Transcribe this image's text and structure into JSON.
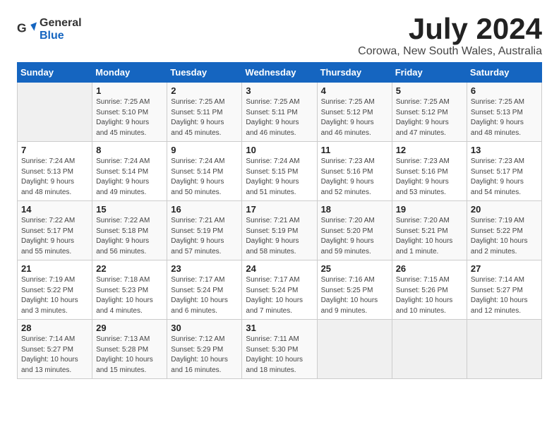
{
  "logo": {
    "general": "General",
    "blue": "Blue"
  },
  "title": "July 2024",
  "location": "Corowa, New South Wales, Australia",
  "days_header": [
    "Sunday",
    "Monday",
    "Tuesday",
    "Wednesday",
    "Thursday",
    "Friday",
    "Saturday"
  ],
  "weeks": [
    [
      {
        "day": "",
        "info": ""
      },
      {
        "day": "1",
        "info": "Sunrise: 7:25 AM\nSunset: 5:10 PM\nDaylight: 9 hours\nand 45 minutes."
      },
      {
        "day": "2",
        "info": "Sunrise: 7:25 AM\nSunset: 5:11 PM\nDaylight: 9 hours\nand 45 minutes."
      },
      {
        "day": "3",
        "info": "Sunrise: 7:25 AM\nSunset: 5:11 PM\nDaylight: 9 hours\nand 46 minutes."
      },
      {
        "day": "4",
        "info": "Sunrise: 7:25 AM\nSunset: 5:12 PM\nDaylight: 9 hours\nand 46 minutes."
      },
      {
        "day": "5",
        "info": "Sunrise: 7:25 AM\nSunset: 5:12 PM\nDaylight: 9 hours\nand 47 minutes."
      },
      {
        "day": "6",
        "info": "Sunrise: 7:25 AM\nSunset: 5:13 PM\nDaylight: 9 hours\nand 48 minutes."
      }
    ],
    [
      {
        "day": "7",
        "info": "Sunrise: 7:24 AM\nSunset: 5:13 PM\nDaylight: 9 hours\nand 48 minutes."
      },
      {
        "day": "8",
        "info": "Sunrise: 7:24 AM\nSunset: 5:14 PM\nDaylight: 9 hours\nand 49 minutes."
      },
      {
        "day": "9",
        "info": "Sunrise: 7:24 AM\nSunset: 5:14 PM\nDaylight: 9 hours\nand 50 minutes."
      },
      {
        "day": "10",
        "info": "Sunrise: 7:24 AM\nSunset: 5:15 PM\nDaylight: 9 hours\nand 51 minutes."
      },
      {
        "day": "11",
        "info": "Sunrise: 7:23 AM\nSunset: 5:16 PM\nDaylight: 9 hours\nand 52 minutes."
      },
      {
        "day": "12",
        "info": "Sunrise: 7:23 AM\nSunset: 5:16 PM\nDaylight: 9 hours\nand 53 minutes."
      },
      {
        "day": "13",
        "info": "Sunrise: 7:23 AM\nSunset: 5:17 PM\nDaylight: 9 hours\nand 54 minutes."
      }
    ],
    [
      {
        "day": "14",
        "info": "Sunrise: 7:22 AM\nSunset: 5:17 PM\nDaylight: 9 hours\nand 55 minutes."
      },
      {
        "day": "15",
        "info": "Sunrise: 7:22 AM\nSunset: 5:18 PM\nDaylight: 9 hours\nand 56 minutes."
      },
      {
        "day": "16",
        "info": "Sunrise: 7:21 AM\nSunset: 5:19 PM\nDaylight: 9 hours\nand 57 minutes."
      },
      {
        "day": "17",
        "info": "Sunrise: 7:21 AM\nSunset: 5:19 PM\nDaylight: 9 hours\nand 58 minutes."
      },
      {
        "day": "18",
        "info": "Sunrise: 7:20 AM\nSunset: 5:20 PM\nDaylight: 9 hours\nand 59 minutes."
      },
      {
        "day": "19",
        "info": "Sunrise: 7:20 AM\nSunset: 5:21 PM\nDaylight: 10 hours\nand 1 minute."
      },
      {
        "day": "20",
        "info": "Sunrise: 7:19 AM\nSunset: 5:22 PM\nDaylight: 10 hours\nand 2 minutes."
      }
    ],
    [
      {
        "day": "21",
        "info": "Sunrise: 7:19 AM\nSunset: 5:22 PM\nDaylight: 10 hours\nand 3 minutes."
      },
      {
        "day": "22",
        "info": "Sunrise: 7:18 AM\nSunset: 5:23 PM\nDaylight: 10 hours\nand 4 minutes."
      },
      {
        "day": "23",
        "info": "Sunrise: 7:17 AM\nSunset: 5:24 PM\nDaylight: 10 hours\nand 6 minutes."
      },
      {
        "day": "24",
        "info": "Sunrise: 7:17 AM\nSunset: 5:24 PM\nDaylight: 10 hours\nand 7 minutes."
      },
      {
        "day": "25",
        "info": "Sunrise: 7:16 AM\nSunset: 5:25 PM\nDaylight: 10 hours\nand 9 minutes."
      },
      {
        "day": "26",
        "info": "Sunrise: 7:15 AM\nSunset: 5:26 PM\nDaylight: 10 hours\nand 10 minutes."
      },
      {
        "day": "27",
        "info": "Sunrise: 7:14 AM\nSunset: 5:27 PM\nDaylight: 10 hours\nand 12 minutes."
      }
    ],
    [
      {
        "day": "28",
        "info": "Sunrise: 7:14 AM\nSunset: 5:27 PM\nDaylight: 10 hours\nand 13 minutes."
      },
      {
        "day": "29",
        "info": "Sunrise: 7:13 AM\nSunset: 5:28 PM\nDaylight: 10 hours\nand 15 minutes."
      },
      {
        "day": "30",
        "info": "Sunrise: 7:12 AM\nSunset: 5:29 PM\nDaylight: 10 hours\nand 16 minutes."
      },
      {
        "day": "31",
        "info": "Sunrise: 7:11 AM\nSunset: 5:30 PM\nDaylight: 10 hours\nand 18 minutes."
      },
      {
        "day": "",
        "info": ""
      },
      {
        "day": "",
        "info": ""
      },
      {
        "day": "",
        "info": ""
      }
    ]
  ]
}
